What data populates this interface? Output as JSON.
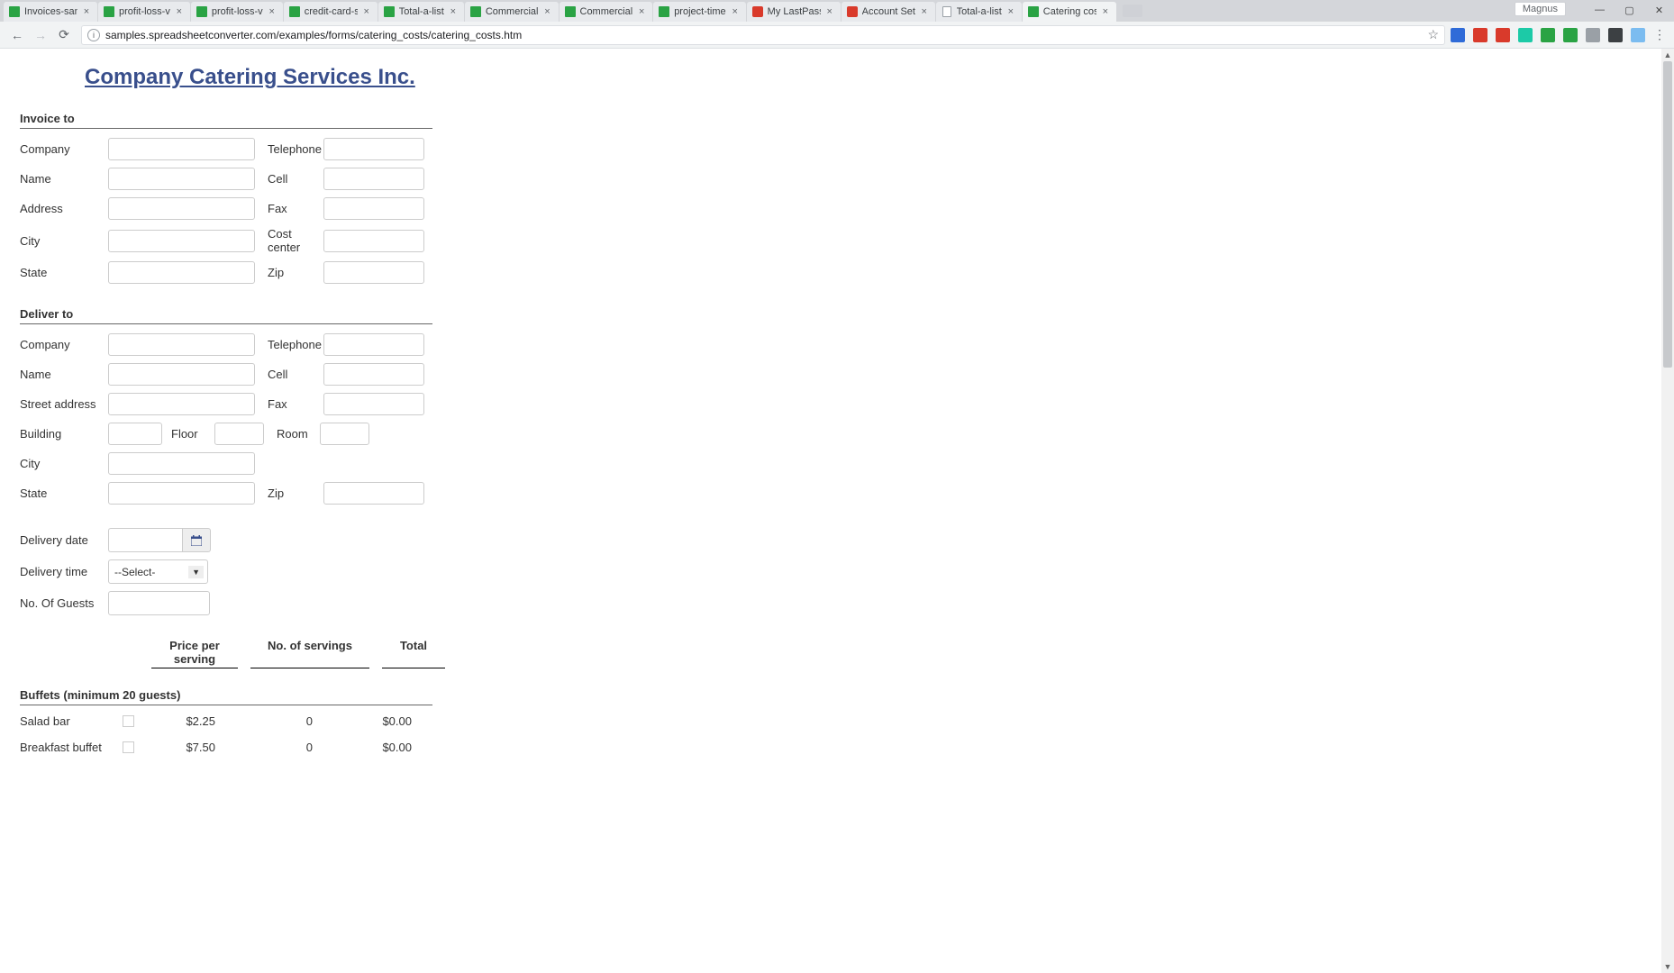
{
  "window": {
    "user": "Magnus",
    "controls": {
      "min": "—",
      "max": "▢",
      "close": "✕"
    }
  },
  "tabs": [
    {
      "title": "Invoices-sam",
      "active": false,
      "icon": "green"
    },
    {
      "title": "profit-loss-v",
      "active": false,
      "icon": "green"
    },
    {
      "title": "profit-loss-v",
      "active": false,
      "icon": "green"
    },
    {
      "title": "credit-card-s",
      "active": false,
      "icon": "green"
    },
    {
      "title": "Total-a-list",
      "active": false,
      "icon": "green"
    },
    {
      "title": "Commercial",
      "active": false,
      "icon": "green"
    },
    {
      "title": "Commercial",
      "active": false,
      "icon": "green"
    },
    {
      "title": "project-time",
      "active": false,
      "icon": "green"
    },
    {
      "title": "My LastPass",
      "active": false,
      "icon": "red"
    },
    {
      "title": "Account Set",
      "active": false,
      "icon": "red"
    },
    {
      "title": "Total-a-list",
      "active": false,
      "icon": "doc"
    },
    {
      "title": "Catering cos",
      "active": true,
      "icon": "green"
    }
  ],
  "toolbar": {
    "nav": {
      "back": "←",
      "forward": "→",
      "reload": "⟳"
    },
    "address": "samples.spreadsheetconverter.com/examples/forms/catering_costs/catering_costs.htm",
    "info_glyph": "i",
    "star_glyph": "☆",
    "menu_glyph": "⋮"
  },
  "form": {
    "title": "Company Catering Services Inc.",
    "invoice_to": {
      "heading": "Invoice to",
      "labels": {
        "company": "Company",
        "telephone": "Telephone",
        "name": "Name",
        "cell": "Cell",
        "address": "Address",
        "fax": "Fax",
        "city": "City",
        "cost_center": "Cost center",
        "state": "State",
        "zip": "Zip"
      }
    },
    "deliver_to": {
      "heading": "Deliver to",
      "labels": {
        "company": "Company",
        "telephone": "Telephone",
        "name": "Name",
        "cell": "Cell",
        "street_address": "Street address",
        "fax": "Fax",
        "building": "Building",
        "floor": "Floor",
        "room": "Room",
        "city": "City",
        "state": "State",
        "zip": "Zip"
      }
    },
    "delivery": {
      "date_label": "Delivery date",
      "time_label": "Delivery time",
      "time_select": "--Select-",
      "guests_label": "No. Of Guests"
    },
    "table": {
      "head": {
        "price": "Price per serving",
        "servings": "No. of servings",
        "total": "Total"
      },
      "buffets_heading": "Buffets (minimum 20 guests)",
      "rows": [
        {
          "name": "Salad bar",
          "price": "$2.25",
          "servings": "0",
          "total": "$0.00"
        },
        {
          "name": "Breakfast buffet",
          "price": "$7.50",
          "servings": "0",
          "total": "$0.00"
        }
      ]
    }
  }
}
